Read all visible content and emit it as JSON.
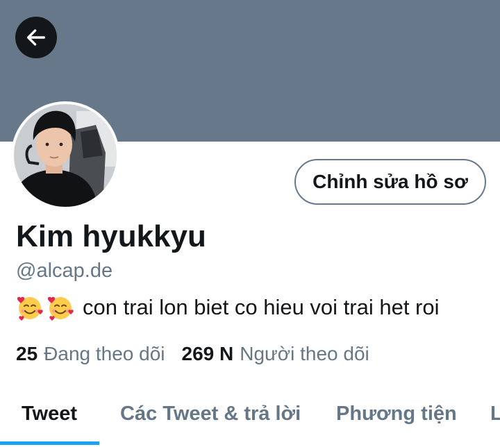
{
  "colors": {
    "banner": "#66788a",
    "accent": "#1da1f2",
    "secondary_text": "#657786",
    "primary_text": "#14171a"
  },
  "header": {
    "back_icon": "arrow-left-icon"
  },
  "profile": {
    "display_name": "Kim hyukkyu",
    "handle": "@alcap.de",
    "bio_emojis": [
      "smiling-face-with-hearts",
      "smiling-face-with-hearts"
    ],
    "bio_text": "con trai lon biet co hieu voi trai het roi",
    "edit_button_label": "Chỉnh sửa hồ sơ"
  },
  "stats": {
    "following_count": "25",
    "following_label": "Đang theo dõi",
    "followers_count": "269 N",
    "followers_label": "Người theo dõi"
  },
  "tabs": [
    {
      "label": "Tweet",
      "active": true
    },
    {
      "label": "Các Tweet & trả lời",
      "active": false
    },
    {
      "label": "Phương tiện",
      "active": false
    },
    {
      "label": "L",
      "active": false
    }
  ]
}
